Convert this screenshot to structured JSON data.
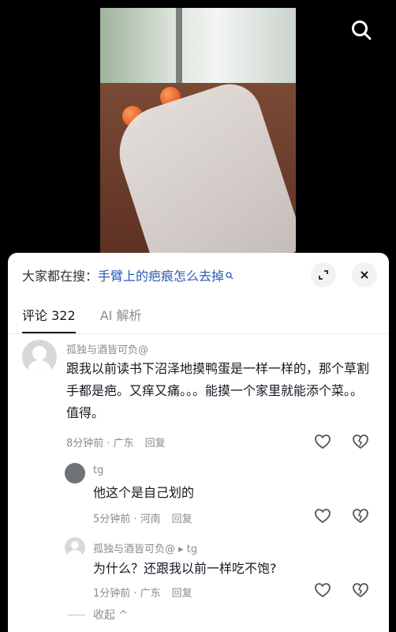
{
  "search_bar": {
    "prefix": "大家都在搜：",
    "query": "手臂上的疤痕怎么去掉"
  },
  "tabs": [
    {
      "label": "评论 322"
    },
    {
      "label": "AI 解析"
    }
  ],
  "comments": [
    {
      "username": "孤独与酒皆可负@",
      "text": "跟我以前读书下沼泽地摸鸭蛋是一样一样的，那个草割手都是疤。又痒又痛。。。能摸一个家里就能添个菜。。值得。",
      "time": "8分钟前 · 广东",
      "reply_label": "回复"
    },
    {
      "username": "tg",
      "text": "他这个是自己划的",
      "time": "5分钟前 · 河南",
      "reply_label": "回复"
    },
    {
      "username": "孤独与酒皆可负@ ▸ tg",
      "text": "为什么？还跟我以前一样吃不饱?",
      "time": "1分钟前 · 广东",
      "reply_label": "回复"
    }
  ],
  "collapse_label": "收起 ^",
  "colors": {
    "accent": "#2a5bb8",
    "muted": "#8a8b91"
  }
}
